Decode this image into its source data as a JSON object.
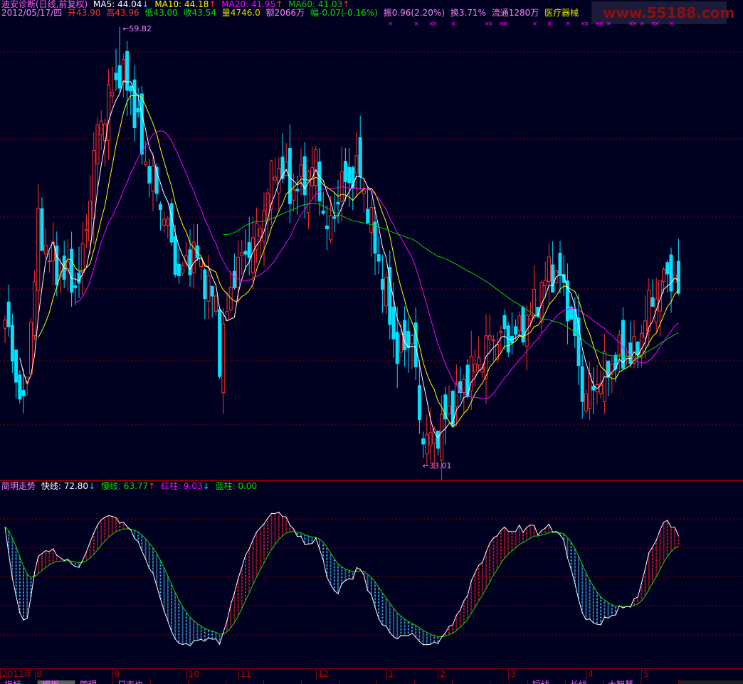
{
  "header": {
    "title": "迪安诊断(日线,前复权)",
    "ma5": "MA5: 44.04",
    "ma5_arrow": "↓",
    "ma10": "MA10: 44.18",
    "ma10_arrow": "↑",
    "ma20": "MA20: 41.95",
    "ma20_arrow": "↑",
    "ma60": "MA60: 41.03",
    "ma60_arrow": "↑"
  },
  "quote": {
    "date": "2012/05/17/四",
    "open": "开43.90",
    "high": "高43.96",
    "low": "低43.00",
    "close": "收43.54",
    "volume": "量4746.0",
    "amount": "额2066万",
    "change": "幅-0.07(-0.16%)",
    "amplitude": "振0.96(2.20%)",
    "turnover": "换3.71%",
    "float": "流通1280万",
    "sector": "医疗器械"
  },
  "logo": {
    "text": "www.55188.com"
  },
  "indicator": {
    "name": "简明走势",
    "fast": "快线: 72.80",
    "fast_arrow": "↓",
    "slow": "慢线: 63.77",
    "slow_arrow": "↑",
    "red": "红柱: 9.03",
    "red_arrow": "↓",
    "blue": "蓝柱: 0.00"
  },
  "axis": {
    "months": [
      {
        "label": "2011年",
        "day": 0
      },
      {
        "label": "8",
        "day": 8
      },
      {
        "label": "9",
        "day": 29
      },
      {
        "label": "10",
        "day": 49
      },
      {
        "label": "11",
        "day": 63
      },
      {
        "label": "12",
        "day": 84
      },
      {
        "label": "1",
        "day": 103
      },
      {
        "label": "2",
        "day": 117
      },
      {
        "label": "3",
        "day": 136
      },
      {
        "label": "4",
        "day": 157
      },
      {
        "label": "5",
        "day": 172
      }
    ]
  },
  "tabs": [
    "指标",
    "模板",
    "管理",
    "日志也",
    "",
    "",
    "",
    "",
    "",
    "",
    "",
    "",
    "",
    "",
    "短线",
    "长线",
    "大智慧",
    ""
  ],
  "colors": {
    "up": "#ff3030",
    "down": "#00e0ff",
    "ma5": "#ffffff",
    "ma10": "#ffff00",
    "ma20": "#ff00ff",
    "ma60": "#00d000",
    "grid": "#8a0000"
  },
  "chart_data": {
    "type": "candlestick",
    "title": "迪安诊断(日线,前复权)",
    "days": 183,
    "close_keypoints": [
      [
        0,
        41.9
      ],
      [
        5,
        36.2
      ],
      [
        9,
        47.5
      ],
      [
        14,
        44.9
      ],
      [
        20,
        44.0
      ],
      [
        25,
        53.6
      ],
      [
        31,
        57.1
      ],
      [
        34,
        55.8
      ],
      [
        37,
        52.3
      ],
      [
        43,
        48.4
      ],
      [
        47,
        44.5
      ],
      [
        51,
        46.2
      ],
      [
        57,
        42.8
      ],
      [
        58,
        39.7
      ],
      [
        62,
        44.9
      ],
      [
        68,
        47.1
      ],
      [
        73,
        51.5
      ],
      [
        78,
        49.7
      ],
      [
        84,
        51.5
      ],
      [
        87,
        47.1
      ],
      [
        91,
        50.2
      ],
      [
        96,
        51.0
      ],
      [
        99,
        47.5
      ],
      [
        102,
        44.5
      ],
      [
        106,
        39.7
      ],
      [
        110,
        41.0
      ],
      [
        112,
        35.8
      ],
      [
        114,
        34.5
      ],
      [
        118,
        35.4
      ],
      [
        122,
        37.1
      ],
      [
        126,
        38.8
      ],
      [
        132,
        41.0
      ],
      [
        137,
        40.6
      ],
      [
        142,
        42.3
      ],
      [
        147,
        44.9
      ],
      [
        150,
        44.5
      ],
      [
        153,
        41.9
      ],
      [
        156,
        37.5
      ],
      [
        159,
        37.9
      ],
      [
        162,
        38.8
      ],
      [
        166,
        39.7
      ],
      [
        170,
        39.7
      ],
      [
        174,
        42.8
      ],
      [
        179,
        44.9
      ],
      [
        182,
        43.54
      ]
    ],
    "price_high": {
      "value": 59.82,
      "label": "59.82",
      "day": 31
    },
    "price_low": {
      "value": 33.01,
      "label": "33.01",
      "day": 114
    },
    "yrange": [
      33.01,
      59.82
    ],
    "moving_averages": [
      5,
      10,
      20,
      60
    ],
    "signal_marker_days": [
      104,
      111,
      115,
      116,
      121,
      130,
      131,
      134,
      135,
      143,
      147,
      152,
      156,
      157,
      160,
      161,
      163,
      169,
      170,
      172,
      175,
      176,
      180
    ],
    "oscillator": {
      "range": [
        0,
        100
      ],
      "fast_last": 72.8,
      "slow_last": 63.77
    }
  }
}
